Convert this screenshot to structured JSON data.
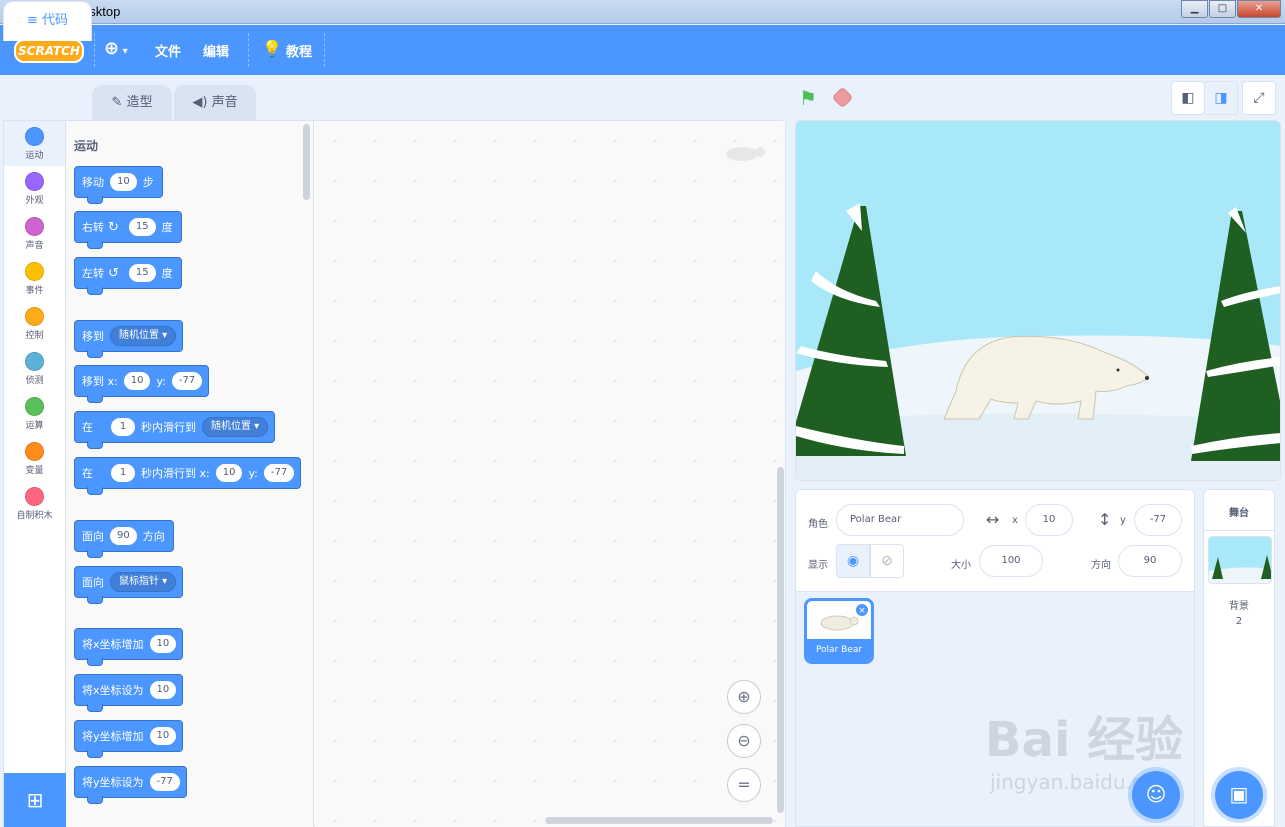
{
  "window": {
    "title": "Scratch Desktop",
    "app_icon": "scratch-cat-icon"
  },
  "menubar": {
    "logo": "SCRATCH",
    "language_icon": "globe-icon",
    "file": "文件",
    "edit": "编辑",
    "tutorials": "教程",
    "tutorials_icon": "lightbulb-icon"
  },
  "tabs": [
    {
      "label": "代码",
      "icon": "code-icon",
      "active": true
    },
    {
      "label": "造型",
      "icon": "brush-icon",
      "active": false
    },
    {
      "label": "声音",
      "icon": "speaker-icon",
      "active": false
    }
  ],
  "categories": [
    {
      "label": "运动",
      "color": "#4c97ff"
    },
    {
      "label": "外观",
      "color": "#9966ff"
    },
    {
      "label": "声音",
      "color": "#cf63cf"
    },
    {
      "label": "事件",
      "color": "#ffbf00"
    },
    {
      "label": "控制",
      "color": "#ffab19"
    },
    {
      "label": "侦测",
      "color": "#5cb1d6"
    },
    {
      "label": "运算",
      "color": "#59c059"
    },
    {
      "label": "变量",
      "color": "#ff8c1a"
    },
    {
      "label": "自制积木",
      "color": "#ff6680"
    }
  ],
  "flyout": {
    "section_title": "运动",
    "blocks": {
      "move": {
        "a": "移动",
        "v": "10",
        "b": "步"
      },
      "turn_right": {
        "a": "右转",
        "v": "15",
        "b": "度"
      },
      "turn_left": {
        "a": "左转",
        "v": "15",
        "b": "度"
      },
      "goto": {
        "a": "移到",
        "dd": "随机位置"
      },
      "goto_xy": {
        "a": "移到 x:",
        "x": "10",
        "ylab": "y:",
        "y": "-77"
      },
      "glide": {
        "a": "在",
        "v": "1",
        "b": "秒内滑行到",
        "dd": "随机位置"
      },
      "glide_xy": {
        "a": "在",
        "v": "1",
        "b": "秒内滑行到 x:",
        "x": "10",
        "ylab": "y:",
        "y": "-77"
      },
      "point_dir": {
        "a": "面向",
        "v": "90",
        "b": "方向"
      },
      "point_towards": {
        "a": "面向",
        "dd": "鼠标指针"
      },
      "change_x": {
        "a": "将x坐标增加",
        "v": "10"
      },
      "set_x": {
        "a": "将x坐标设为",
        "v": "10"
      },
      "change_y": {
        "a": "将y坐标增加",
        "v": "10"
      },
      "set_y": {
        "a": "将y坐标设为",
        "v": "-77"
      }
    }
  },
  "workspace": {
    "zoom_in": "+",
    "zoom_out": "−",
    "zoom_reset": "="
  },
  "sprite_info": {
    "sprite_label": "角色",
    "sprite_name": "Polar Bear",
    "x_label": "x",
    "x": "10",
    "y_label": "y",
    "y": "-77",
    "show_label": "显示",
    "size_label": "大小",
    "size": "100",
    "direction_label": "方向",
    "direction": "90"
  },
  "sprites": [
    {
      "name": "Polar Bear",
      "selected": true
    }
  ],
  "stage_pane": {
    "title": "舞台",
    "backdrops_label": "背景",
    "backdrops_count": "2"
  },
  "watermark": {
    "main": "Bai 经验",
    "sub": "jingyan.baidu.com"
  }
}
